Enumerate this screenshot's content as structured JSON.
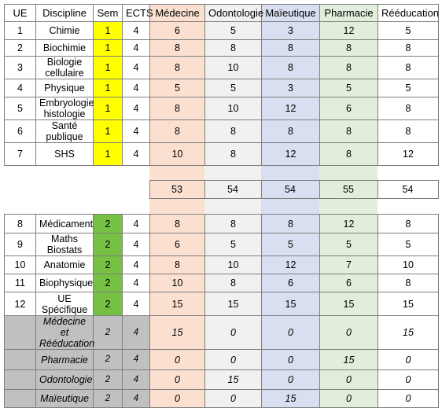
{
  "table": {
    "columns": [
      {
        "key": "ue",
        "label": "UE",
        "style": "plain"
      },
      {
        "key": "disc",
        "label": "Discipline",
        "style": "plain"
      },
      {
        "key": "sem",
        "label": "Sem",
        "style": "plain"
      },
      {
        "key": "ects",
        "label": "ECTS",
        "style": "plain"
      },
      {
        "key": "med",
        "label": "Médecine",
        "style": "med"
      },
      {
        "key": "odo",
        "label": "Odontologie",
        "style": "odo"
      },
      {
        "key": "mai",
        "label": "Maïeutique",
        "style": "mai"
      },
      {
        "key": "pha",
        "label": "Pharmacie",
        "style": "pha"
      },
      {
        "key": "ree",
        "label": "Rééducation",
        "style": "ree"
      }
    ],
    "semester1_rows": [
      {
        "ue": "1",
        "discipline": "Chimie",
        "sem": "1",
        "ects": "4",
        "med": "6",
        "odo": "5",
        "mai": "3",
        "pha": "12",
        "ree": "5"
      },
      {
        "ue": "2",
        "discipline": "Biochimie",
        "sem": "1",
        "ects": "4",
        "med": "8",
        "odo": "8",
        "mai": "8",
        "pha": "8",
        "ree": "8"
      },
      {
        "ue": "3",
        "discipline": "Biologie cellulaire",
        "sem": "1",
        "ects": "4",
        "med": "8",
        "odo": "10",
        "mai": "8",
        "pha": "8",
        "ree": "8"
      },
      {
        "ue": "4",
        "discipline": "Physique",
        "sem": "1",
        "ects": "4",
        "med": "5",
        "odo": "5",
        "mai": "3",
        "pha": "5",
        "ree": "5"
      },
      {
        "ue": "5",
        "discipline": "Embryologie histologie",
        "sem": "1",
        "ects": "4",
        "med": "8",
        "odo": "10",
        "mai": "12",
        "pha": "6",
        "ree": "8"
      },
      {
        "ue": "6",
        "discipline": "Santé publique",
        "sem": "1",
        "ects": "4",
        "med": "8",
        "odo": "8",
        "mai": "8",
        "pha": "8",
        "ree": "8"
      },
      {
        "ue": "7",
        "discipline": "SHS",
        "sem": "1",
        "ects": "4",
        "med": "10",
        "odo": "8",
        "mai": "12",
        "pha": "8",
        "ree": "12"
      }
    ],
    "totals": {
      "med": "53",
      "odo": "54",
      "mai": "54",
      "pha": "55",
      "ree": "54"
    },
    "semester2_rows": [
      {
        "ue": "8",
        "discipline": "Médicament",
        "sem": "2",
        "ects": "4",
        "med": "8",
        "odo": "8",
        "mai": "8",
        "pha": "12",
        "ree": "8"
      },
      {
        "ue": "9",
        "discipline": "Maths Biostats",
        "sem": "2",
        "ects": "4",
        "med": "6",
        "odo": "5",
        "mai": "5",
        "pha": "5",
        "ree": "5"
      },
      {
        "ue": "10",
        "discipline": "Anatomie",
        "sem": "2",
        "ects": "4",
        "med": "8",
        "odo": "10",
        "mai": "12",
        "pha": "7",
        "ree": "10"
      },
      {
        "ue": "11",
        "discipline": "Biophysique",
        "sem": "2",
        "ects": "4",
        "med": "10",
        "odo": "8",
        "mai": "6",
        "pha": "6",
        "ree": "8"
      },
      {
        "ue": "12",
        "discipline": "UE Spécifique",
        "sem": "2",
        "ects": "4",
        "med": "15",
        "odo": "15",
        "mai": "15",
        "pha": "15",
        "ree": "15"
      }
    ],
    "specific_rows": [
      {
        "ue": "",
        "discipline": "Médecine et Rééducation",
        "sem": "2",
        "ects": "4",
        "med": "15",
        "odo": "0",
        "mai": "0",
        "pha": "0",
        "ree": "15"
      },
      {
        "ue": "",
        "discipline": "Pharmacie",
        "sem": "2",
        "ects": "4",
        "med": "0",
        "odo": "0",
        "mai": "0",
        "pha": "15",
        "ree": "0"
      },
      {
        "ue": "",
        "discipline": "Odontologie",
        "sem": "2",
        "ects": "4",
        "med": "0",
        "odo": "15",
        "mai": "0",
        "pha": "0",
        "ree": "0"
      },
      {
        "ue": "",
        "discipline": "Maïeutique",
        "sem": "2",
        "ects": "4",
        "med": "0",
        "odo": "0",
        "mai": "15",
        "pha": "0",
        "ree": "0"
      }
    ]
  },
  "colors": {
    "medecine_bg": "#fbe0d0",
    "medecine_text": "#943634",
    "odontologie_bg": "#f1f1f1",
    "odontologie_text": "#a6a6a6",
    "maieutique_bg": "#d9dff0",
    "maieutique_text": "#0000d0",
    "pharmacie_bg": "#e2eedc",
    "pharmacie_text": "#1f7a1f",
    "reeducation_bg": "#ffffff",
    "reeducation_text": "#000000",
    "sem1_bg": "#ffff00",
    "sem2_bg": "#76c043",
    "option_row_bg": "#c0c0c0",
    "total_text": "#c00000",
    "grid_line": "#7f7f7f"
  }
}
